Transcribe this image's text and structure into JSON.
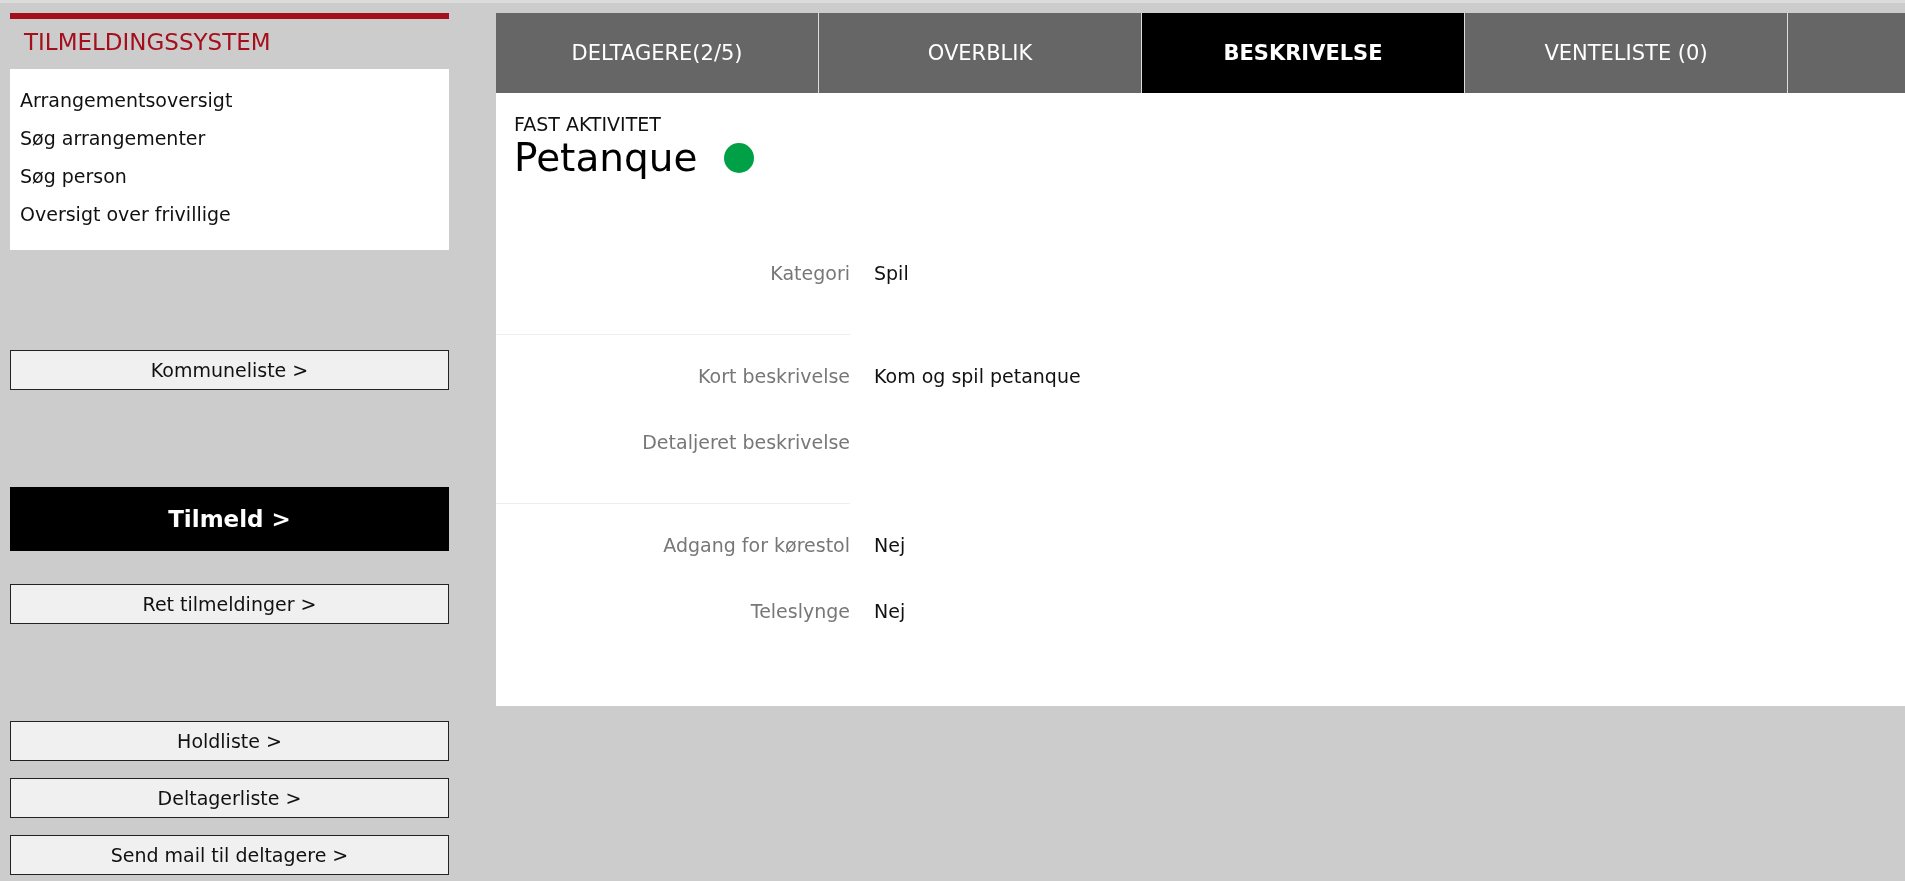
{
  "sidebar": {
    "title": "TILMELDINGSSYSTEM",
    "menu": [
      {
        "label": "Arrangementsoversigt"
      },
      {
        "label": "Søg arrangementer"
      },
      {
        "label": "Søg person"
      },
      {
        "label": "Oversigt over frivillige"
      }
    ],
    "action_groups": [
      [
        {
          "label": "Kommuneliste >",
          "kind": "plain"
        }
      ],
      [
        {
          "label": "Tilmeld >",
          "kind": "primary"
        },
        {
          "label": "Ret tilmeldinger >",
          "kind": "plain"
        }
      ],
      [
        {
          "label": "Holdliste >",
          "kind": "plain"
        },
        {
          "label": "Deltagerliste >",
          "kind": "plain"
        },
        {
          "label": "Send mail til deltagere >",
          "kind": "plain"
        }
      ]
    ]
  },
  "tabs": [
    {
      "label": "DELTAGERE(2/5)",
      "selected": false
    },
    {
      "label": "OVERBLIK",
      "selected": false
    },
    {
      "label": "BESKRIVELSE",
      "selected": true
    },
    {
      "label": "VENTELISTE (0)",
      "selected": false
    },
    {
      "selected": false
    }
  ],
  "activity": {
    "type": "FAST AKTIVITET",
    "title": "Petanque",
    "color": "#00a046"
  },
  "sections": [
    [
      {
        "label": "Kategori",
        "value": "Spil"
      }
    ],
    [
      {
        "label": "Kort beskrivelse",
        "value": "Kom og spil petanque"
      },
      {
        "label": "Detaljeret beskrivelse"
      }
    ],
    [
      {
        "label": "Adgang for kørestol",
        "value": "Nej"
      },
      {
        "label": "Teleslynge",
        "value": "Nej"
      }
    ]
  ]
}
